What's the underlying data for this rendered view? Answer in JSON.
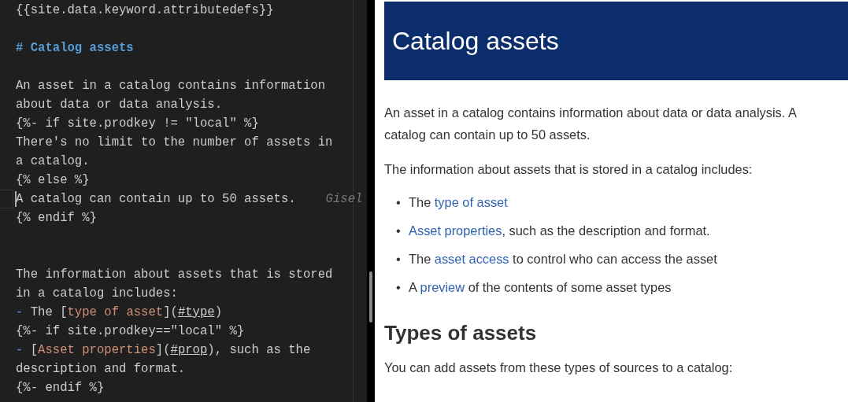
{
  "editor": {
    "lines": [
      {
        "kind": "text",
        "segments": [
          {
            "kind": "plain",
            "text": "{{site.data.keyword.attributedefs}}"
          }
        ]
      },
      {
        "kind": "blank"
      },
      {
        "kind": "text",
        "segments": [
          {
            "kind": "heading",
            "text": "# Catalog assets"
          }
        ]
      },
      {
        "kind": "blank"
      },
      {
        "kind": "text",
        "segments": [
          {
            "kind": "plain",
            "text": "An asset in a catalog contains information"
          }
        ]
      },
      {
        "kind": "text",
        "segments": [
          {
            "kind": "plain",
            "text": "about data or data analysis."
          }
        ]
      },
      {
        "kind": "text",
        "segments": [
          {
            "kind": "plain",
            "text": "{%- if site.prodkey != \"local\" %}"
          }
        ]
      },
      {
        "kind": "text",
        "segments": [
          {
            "kind": "plain",
            "text": "There's no limit to the number of assets in"
          }
        ]
      },
      {
        "kind": "text",
        "segments": [
          {
            "kind": "plain",
            "text": "a catalog."
          }
        ]
      },
      {
        "kind": "text",
        "segments": [
          {
            "kind": "plain",
            "text": "{% else %}"
          }
        ]
      },
      {
        "kind": "text",
        "cursor": true,
        "blame": "Gisel",
        "segments": [
          {
            "kind": "plain",
            "text": "A catalog can contain up to 50 assets."
          }
        ]
      },
      {
        "kind": "text",
        "segments": [
          {
            "kind": "plain",
            "text": "{% endif %}"
          }
        ]
      },
      {
        "kind": "blank"
      },
      {
        "kind": "blank"
      },
      {
        "kind": "text",
        "segments": [
          {
            "kind": "plain",
            "text": "The information about assets that is stored"
          }
        ]
      },
      {
        "kind": "text",
        "segments": [
          {
            "kind": "plain",
            "text": "in a catalog includes:"
          }
        ]
      },
      {
        "kind": "text",
        "segments": [
          {
            "kind": "marker",
            "text": "-"
          },
          {
            "kind": "plain",
            "text": " The ["
          },
          {
            "kind": "linktext",
            "text": "type of asset"
          },
          {
            "kind": "plain",
            "text": "]("
          },
          {
            "kind": "url",
            "text": "#type"
          },
          {
            "kind": "plain",
            "text": ")"
          }
        ]
      },
      {
        "kind": "text",
        "segments": [
          {
            "kind": "plain",
            "text": "{%- if site.prodkey==\"local\" %}"
          }
        ]
      },
      {
        "kind": "text",
        "segments": [
          {
            "kind": "marker",
            "text": "-"
          },
          {
            "kind": "plain",
            "text": " ["
          },
          {
            "kind": "linktext",
            "text": "Asset properties"
          },
          {
            "kind": "plain",
            "text": "]("
          },
          {
            "kind": "url",
            "text": "#prop"
          },
          {
            "kind": "plain",
            "text": "), such as the"
          }
        ]
      },
      {
        "kind": "text",
        "segments": [
          {
            "kind": "plain",
            "text": "description and format."
          }
        ]
      },
      {
        "kind": "text",
        "segments": [
          {
            "kind": "plain",
            "text": "{%- endif %}"
          }
        ]
      }
    ]
  },
  "preview": {
    "title": "Catalog assets",
    "blocks": [
      {
        "kind": "paragraph",
        "segments": [
          {
            "kind": "text",
            "text": "An asset in a catalog contains information about data or data analysis. A catalog can contain up to 50 assets."
          }
        ]
      },
      {
        "kind": "paragraph",
        "segments": [
          {
            "kind": "text",
            "text": "The information about assets that is stored in a catalog includes:"
          }
        ]
      },
      {
        "kind": "list",
        "items": [
          {
            "marker": "•",
            "segments": [
              {
                "kind": "text",
                "text": "The "
              },
              {
                "kind": "link",
                "text": "type of asset"
              }
            ]
          },
          {
            "marker": "•",
            "segments": [
              {
                "kind": "link",
                "text": "Asset properties"
              },
              {
                "kind": "text",
                "text": ", such as the description and format."
              }
            ]
          },
          {
            "marker": "•",
            "segments": [
              {
                "kind": "text",
                "text": "The "
              },
              {
                "kind": "link",
                "text": "asset access"
              },
              {
                "kind": "text",
                "text": " to control who can access the asset"
              }
            ]
          },
          {
            "marker": "•",
            "segments": [
              {
                "kind": "text",
                "text": "A "
              },
              {
                "kind": "link",
                "text": "preview"
              },
              {
                "kind": "text",
                "text": " of the contents of some asset types"
              }
            ]
          }
        ]
      },
      {
        "kind": "heading",
        "segments": [
          {
            "kind": "text",
            "text": "Types of assets"
          }
        ]
      },
      {
        "kind": "paragraph",
        "segments": [
          {
            "kind": "text",
            "text": "You can add assets from these types of sources to a catalog:"
          }
        ]
      }
    ]
  }
}
